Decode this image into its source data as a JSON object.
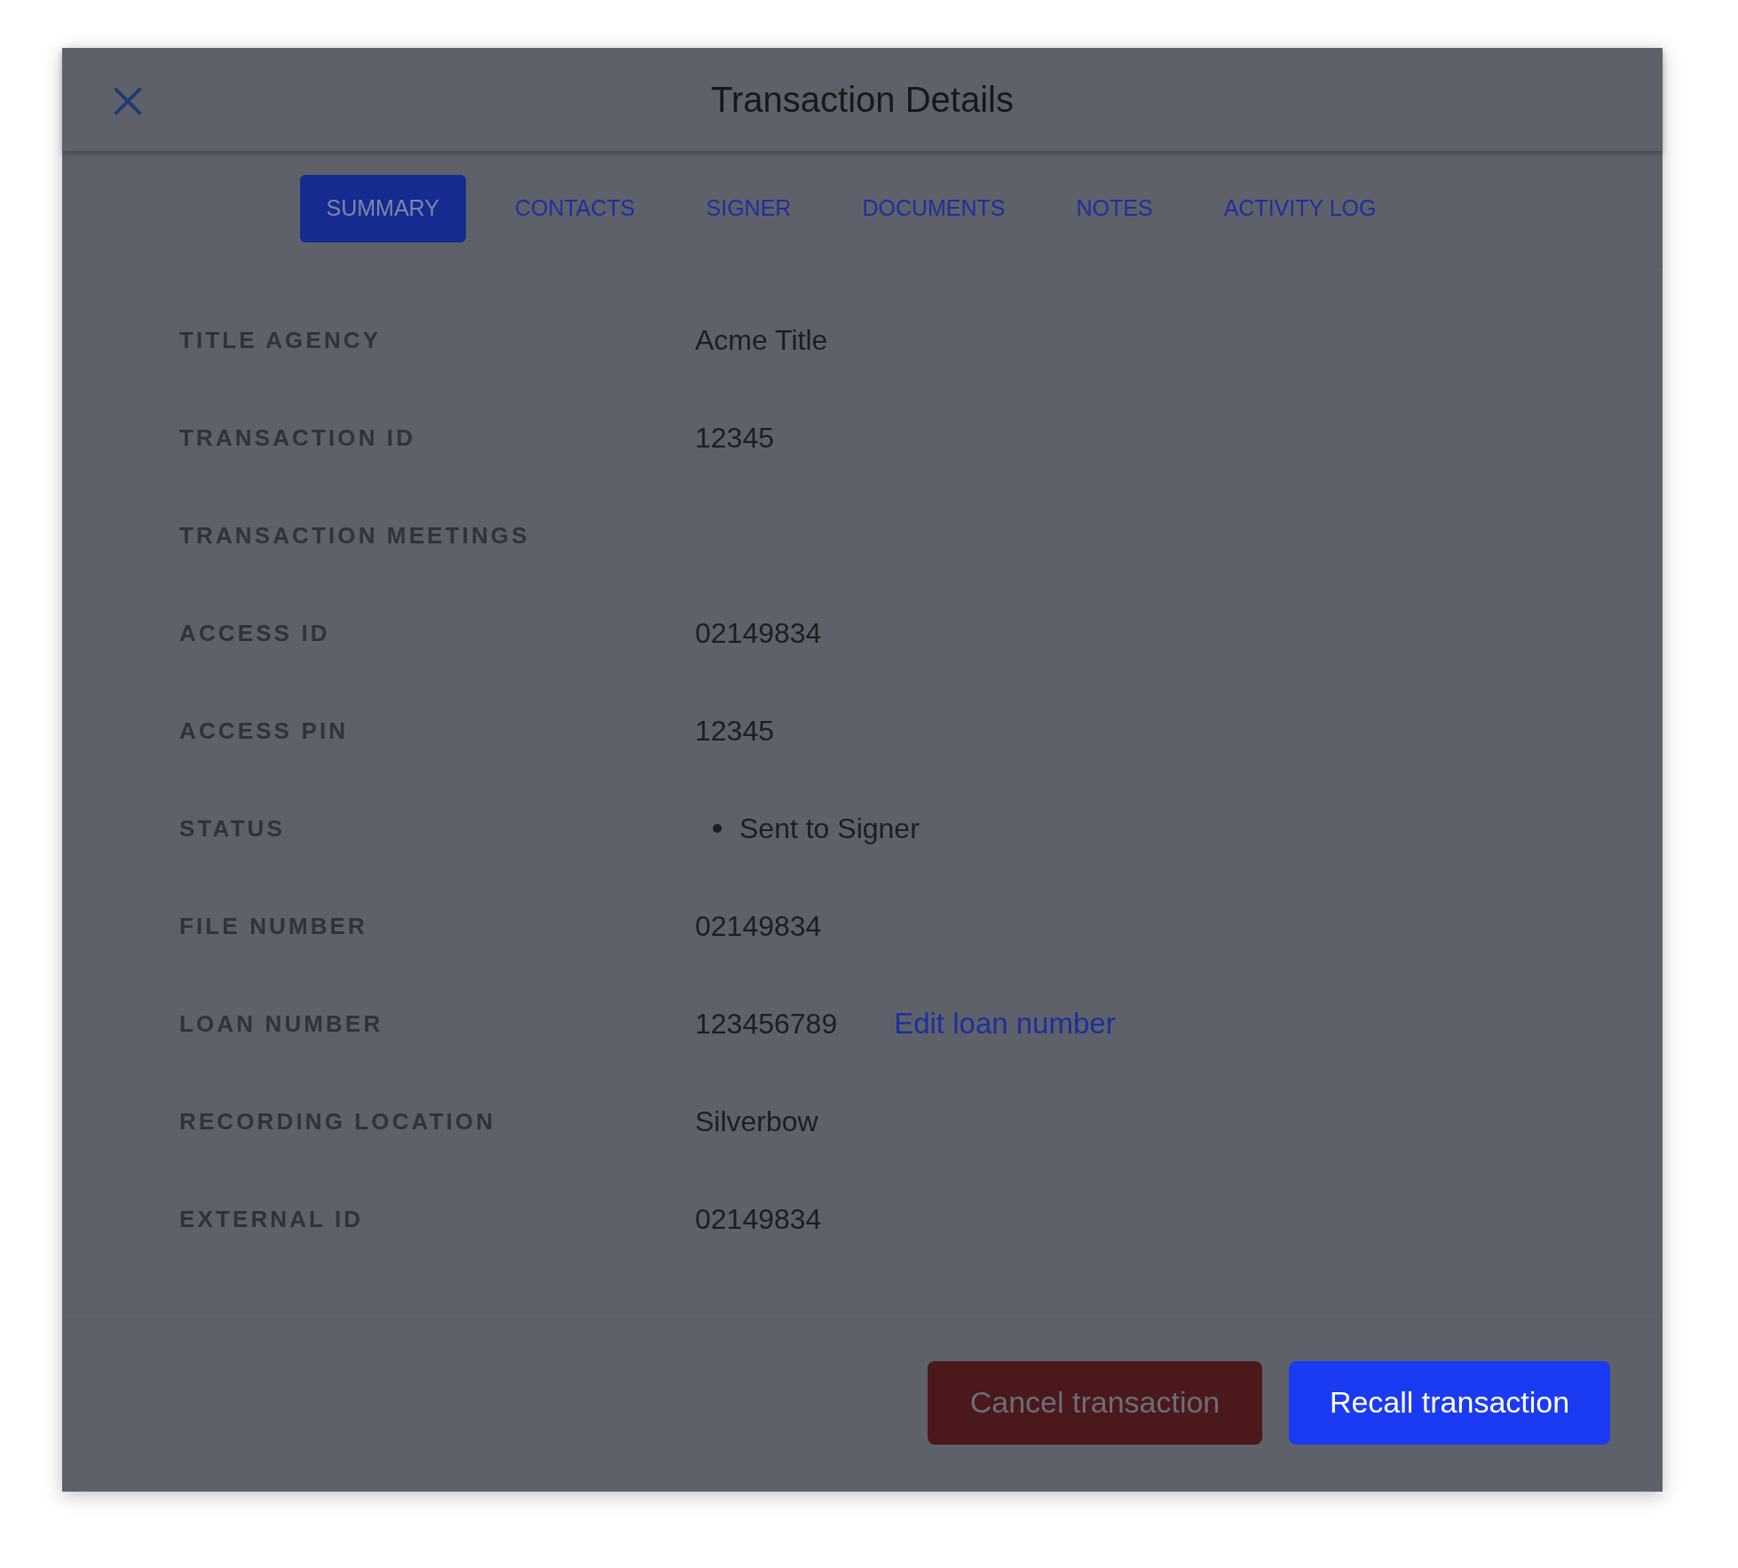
{
  "dialog": {
    "title": "Transaction Details"
  },
  "tabs": [
    {
      "label": "SUMMARY",
      "selected": true
    },
    {
      "label": "CONTACTS",
      "selected": false
    },
    {
      "label": "SIGNER",
      "selected": false
    },
    {
      "label": "DOCUMENTS",
      "selected": false
    },
    {
      "label": "NOTES",
      "selected": false
    },
    {
      "label": "ACTIVITY LOG",
      "selected": false
    }
  ],
  "fields": [
    {
      "label": "TITLE AGENCY",
      "value": "Acme Title",
      "kind": "text"
    },
    {
      "label": "TRANSACTION ID",
      "value": "12345",
      "kind": "text"
    },
    {
      "label": "TRANSACTION MEETINGS",
      "kind": "heading"
    },
    {
      "label": "ACCESS ID",
      "value": "02149834",
      "kind": "text"
    },
    {
      "label": "ACCESS PIN",
      "value": "12345",
      "kind": "text"
    },
    {
      "label": "STATUS",
      "value": "Sent to Signer",
      "kind": "status"
    },
    {
      "label": "FILE NUMBER",
      "value": "02149834",
      "kind": "text"
    },
    {
      "label": "LOAN NUMBER",
      "value": "123456789",
      "link": "Edit loan number",
      "kind": "text"
    },
    {
      "label": "RECORDING LOCATION",
      "value": "Silverbow",
      "kind": "text"
    },
    {
      "label": "EXTERNAL ID",
      "value": "02149834",
      "kind": "text"
    }
  ],
  "buttons": [
    {
      "label": "Cancel transaction",
      "kind": "danger"
    },
    {
      "label": "Recall transaction",
      "kind": "primary"
    }
  ]
}
